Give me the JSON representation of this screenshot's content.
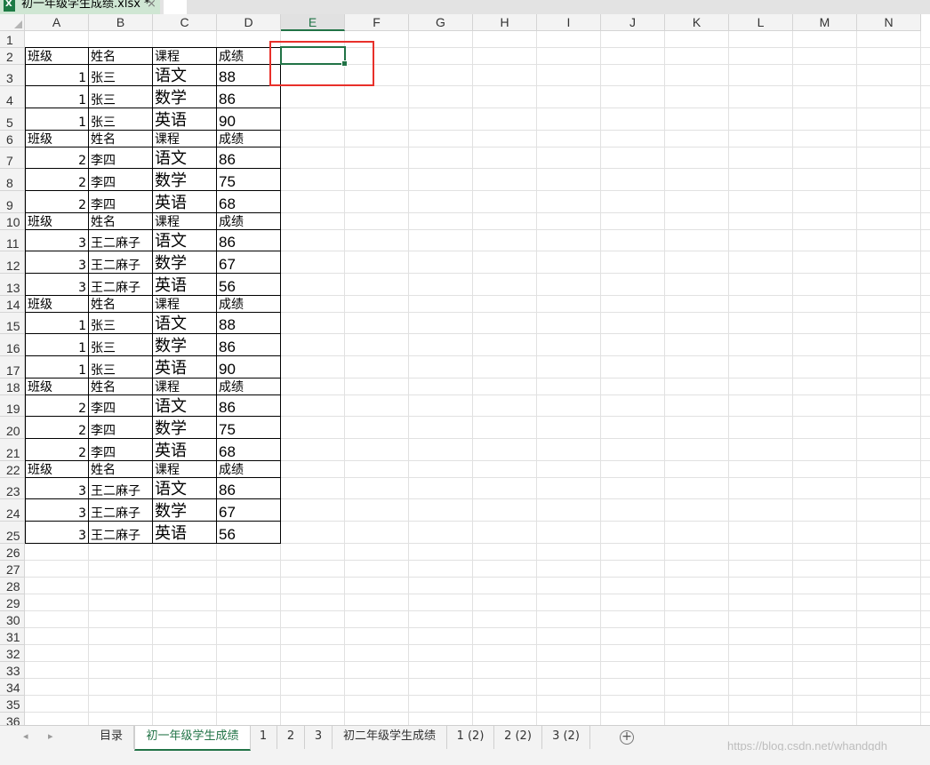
{
  "window": {
    "file_tab_title": "初一年级学生成绩.xlsx *",
    "close_glyph": "×"
  },
  "columns": [
    "A",
    "B",
    "C",
    "D",
    "E",
    "F",
    "G",
    "H",
    "I",
    "J",
    "K",
    "L",
    "M",
    "N"
  ],
  "selected_column": "E",
  "rows": [
    "1",
    "2",
    "3",
    "4",
    "5",
    "6",
    "7",
    "8",
    "9",
    "10",
    "11",
    "12",
    "13",
    "14",
    "15",
    "16",
    "17",
    "18",
    "19",
    "20",
    "21",
    "22",
    "23",
    "24",
    "25",
    "26",
    "27",
    "28",
    "29",
    "30",
    "31",
    "32",
    "33",
    "34",
    "35",
    "36"
  ],
  "cells": [
    {
      "r": 2,
      "c": "A",
      "v": "班级",
      "s": "f13"
    },
    {
      "r": 2,
      "c": "B",
      "v": "姓名",
      "s": "f13"
    },
    {
      "r": 2,
      "c": "C",
      "v": "课程",
      "s": "f13"
    },
    {
      "r": 2,
      "c": "D",
      "v": "成绩",
      "s": "f13"
    },
    {
      "r": 3,
      "c": "A",
      "v": "1",
      "s": "f13",
      "num": true
    },
    {
      "r": 3,
      "c": "B",
      "v": "张三",
      "s": "f13"
    },
    {
      "r": 3,
      "c": "C",
      "v": "语文",
      "s": "f17"
    },
    {
      "r": 3,
      "c": "D",
      "v": "88",
      "s": "fnum"
    },
    {
      "r": 4,
      "c": "A",
      "v": "1",
      "s": "f13",
      "num": true
    },
    {
      "r": 4,
      "c": "B",
      "v": "张三",
      "s": "f13"
    },
    {
      "r": 4,
      "c": "C",
      "v": "数学",
      "s": "f17"
    },
    {
      "r": 4,
      "c": "D",
      "v": "86",
      "s": "fnum"
    },
    {
      "r": 5,
      "c": "A",
      "v": "1",
      "s": "f13",
      "num": true
    },
    {
      "r": 5,
      "c": "B",
      "v": "张三",
      "s": "f13"
    },
    {
      "r": 5,
      "c": "C",
      "v": "英语",
      "s": "f17"
    },
    {
      "r": 5,
      "c": "D",
      "v": "90",
      "s": "fnum"
    },
    {
      "r": 6,
      "c": "A",
      "v": "班级",
      "s": "f13"
    },
    {
      "r": 6,
      "c": "B",
      "v": "姓名",
      "s": "f13"
    },
    {
      "r": 6,
      "c": "C",
      "v": "课程",
      "s": "f13"
    },
    {
      "r": 6,
      "c": "D",
      "v": "成绩",
      "s": "f13"
    },
    {
      "r": 7,
      "c": "A",
      "v": "2",
      "s": "f13",
      "num": true
    },
    {
      "r": 7,
      "c": "B",
      "v": "李四",
      "s": "f13"
    },
    {
      "r": 7,
      "c": "C",
      "v": "语文",
      "s": "f17"
    },
    {
      "r": 7,
      "c": "D",
      "v": "86",
      "s": "fnum"
    },
    {
      "r": 8,
      "c": "A",
      "v": "2",
      "s": "f13",
      "num": true
    },
    {
      "r": 8,
      "c": "B",
      "v": "李四",
      "s": "f13"
    },
    {
      "r": 8,
      "c": "C",
      "v": "数学",
      "s": "f17"
    },
    {
      "r": 8,
      "c": "D",
      "v": "75",
      "s": "fnum"
    },
    {
      "r": 9,
      "c": "A",
      "v": "2",
      "s": "f13",
      "num": true
    },
    {
      "r": 9,
      "c": "B",
      "v": "李四",
      "s": "f13"
    },
    {
      "r": 9,
      "c": "C",
      "v": "英语",
      "s": "f17"
    },
    {
      "r": 9,
      "c": "D",
      "v": "68",
      "s": "fnum"
    },
    {
      "r": 10,
      "c": "A",
      "v": "班级",
      "s": "f13"
    },
    {
      "r": 10,
      "c": "B",
      "v": "姓名",
      "s": "f13"
    },
    {
      "r": 10,
      "c": "C",
      "v": "课程",
      "s": "f13"
    },
    {
      "r": 10,
      "c": "D",
      "v": "成绩",
      "s": "f13"
    },
    {
      "r": 11,
      "c": "A",
      "v": "3",
      "s": "f13",
      "num": true
    },
    {
      "r": 11,
      "c": "B",
      "v": "王二麻子",
      "s": "f13"
    },
    {
      "r": 11,
      "c": "C",
      "v": "语文",
      "s": "f17"
    },
    {
      "r": 11,
      "c": "D",
      "v": "86",
      "s": "fnum"
    },
    {
      "r": 12,
      "c": "A",
      "v": "3",
      "s": "f13",
      "num": true
    },
    {
      "r": 12,
      "c": "B",
      "v": "王二麻子",
      "s": "f13"
    },
    {
      "r": 12,
      "c": "C",
      "v": "数学",
      "s": "f17"
    },
    {
      "r": 12,
      "c": "D",
      "v": "67",
      "s": "fnum"
    },
    {
      "r": 13,
      "c": "A",
      "v": "3",
      "s": "f13",
      "num": true
    },
    {
      "r": 13,
      "c": "B",
      "v": "王二麻子",
      "s": "f13"
    },
    {
      "r": 13,
      "c": "C",
      "v": "英语",
      "s": "f17"
    },
    {
      "r": 13,
      "c": "D",
      "v": "56",
      "s": "fnum"
    },
    {
      "r": 14,
      "c": "A",
      "v": "班级",
      "s": "f13"
    },
    {
      "r": 14,
      "c": "B",
      "v": "姓名",
      "s": "f13"
    },
    {
      "r": 14,
      "c": "C",
      "v": "课程",
      "s": "f13"
    },
    {
      "r": 14,
      "c": "D",
      "v": "成绩",
      "s": "f13"
    },
    {
      "r": 15,
      "c": "A",
      "v": "1",
      "s": "f13",
      "num": true
    },
    {
      "r": 15,
      "c": "B",
      "v": "张三",
      "s": "f13"
    },
    {
      "r": 15,
      "c": "C",
      "v": "语文",
      "s": "f17"
    },
    {
      "r": 15,
      "c": "D",
      "v": "88",
      "s": "fnum"
    },
    {
      "r": 16,
      "c": "A",
      "v": "1",
      "s": "f13",
      "num": true
    },
    {
      "r": 16,
      "c": "B",
      "v": "张三",
      "s": "f13"
    },
    {
      "r": 16,
      "c": "C",
      "v": "数学",
      "s": "f17"
    },
    {
      "r": 16,
      "c": "D",
      "v": "86",
      "s": "fnum"
    },
    {
      "r": 17,
      "c": "A",
      "v": "1",
      "s": "f13",
      "num": true
    },
    {
      "r": 17,
      "c": "B",
      "v": "张三",
      "s": "f13"
    },
    {
      "r": 17,
      "c": "C",
      "v": "英语",
      "s": "f17"
    },
    {
      "r": 17,
      "c": "D",
      "v": "90",
      "s": "fnum"
    },
    {
      "r": 18,
      "c": "A",
      "v": "班级",
      "s": "f13"
    },
    {
      "r": 18,
      "c": "B",
      "v": "姓名",
      "s": "f13"
    },
    {
      "r": 18,
      "c": "C",
      "v": "课程",
      "s": "f13"
    },
    {
      "r": 18,
      "c": "D",
      "v": "成绩",
      "s": "f13"
    },
    {
      "r": 19,
      "c": "A",
      "v": "2",
      "s": "f13",
      "num": true
    },
    {
      "r": 19,
      "c": "B",
      "v": "李四",
      "s": "f13"
    },
    {
      "r": 19,
      "c": "C",
      "v": "语文",
      "s": "f17"
    },
    {
      "r": 19,
      "c": "D",
      "v": "86",
      "s": "fnum"
    },
    {
      "r": 20,
      "c": "A",
      "v": "2",
      "s": "f13",
      "num": true
    },
    {
      "r": 20,
      "c": "B",
      "v": "李四",
      "s": "f13"
    },
    {
      "r": 20,
      "c": "C",
      "v": "数学",
      "s": "f17"
    },
    {
      "r": 20,
      "c": "D",
      "v": "75",
      "s": "fnum"
    },
    {
      "r": 21,
      "c": "A",
      "v": "2",
      "s": "f13",
      "num": true
    },
    {
      "r": 21,
      "c": "B",
      "v": "李四",
      "s": "f13"
    },
    {
      "r": 21,
      "c": "C",
      "v": "英语",
      "s": "f17"
    },
    {
      "r": 21,
      "c": "D",
      "v": "68",
      "s": "fnum"
    },
    {
      "r": 22,
      "c": "A",
      "v": "班级",
      "s": "f13"
    },
    {
      "r": 22,
      "c": "B",
      "v": "姓名",
      "s": "f13"
    },
    {
      "r": 22,
      "c": "C",
      "v": "课程",
      "s": "f13"
    },
    {
      "r": 22,
      "c": "D",
      "v": "成绩",
      "s": "f13"
    },
    {
      "r": 23,
      "c": "A",
      "v": "3",
      "s": "f13",
      "num": true
    },
    {
      "r": 23,
      "c": "B",
      "v": "王二麻子",
      "s": "f13"
    },
    {
      "r": 23,
      "c": "C",
      "v": "语文",
      "s": "f17"
    },
    {
      "r": 23,
      "c": "D",
      "v": "86",
      "s": "fnum"
    },
    {
      "r": 24,
      "c": "A",
      "v": "3",
      "s": "f13",
      "num": true
    },
    {
      "r": 24,
      "c": "B",
      "v": "王二麻子",
      "s": "f13"
    },
    {
      "r": 24,
      "c": "C",
      "v": "数学",
      "s": "f17"
    },
    {
      "r": 24,
      "c": "D",
      "v": "67",
      "s": "fnum"
    },
    {
      "r": 25,
      "c": "A",
      "v": "3",
      "s": "f13",
      "num": true
    },
    {
      "r": 25,
      "c": "B",
      "v": "王二麻子",
      "s": "f13"
    },
    {
      "r": 25,
      "c": "C",
      "v": "英语",
      "s": "f17"
    },
    {
      "r": 25,
      "c": "D",
      "v": "56",
      "s": "fnum"
    }
  ],
  "sheet_tabs": [
    {
      "label": "目录",
      "active": false
    },
    {
      "label": "初一年级学生成绩",
      "active": true
    },
    {
      "label": "1",
      "active": false
    },
    {
      "label": "2",
      "active": false
    },
    {
      "label": "3",
      "active": false
    },
    {
      "label": "初二年级学生成绩",
      "active": false
    },
    {
      "label": "1 (2)",
      "active": false
    },
    {
      "label": "2 (2)",
      "active": false
    },
    {
      "label": "3 (2)",
      "active": false
    }
  ],
  "sheet_nav": {
    "prev_glyph": "◂",
    "next_glyph": "▸"
  },
  "add_sheet_glyph": "+",
  "watermark": "https://blog.csdn.net/whandgdh",
  "colors": {
    "accent": "#217346",
    "highlight_box": "#e8302a"
  }
}
